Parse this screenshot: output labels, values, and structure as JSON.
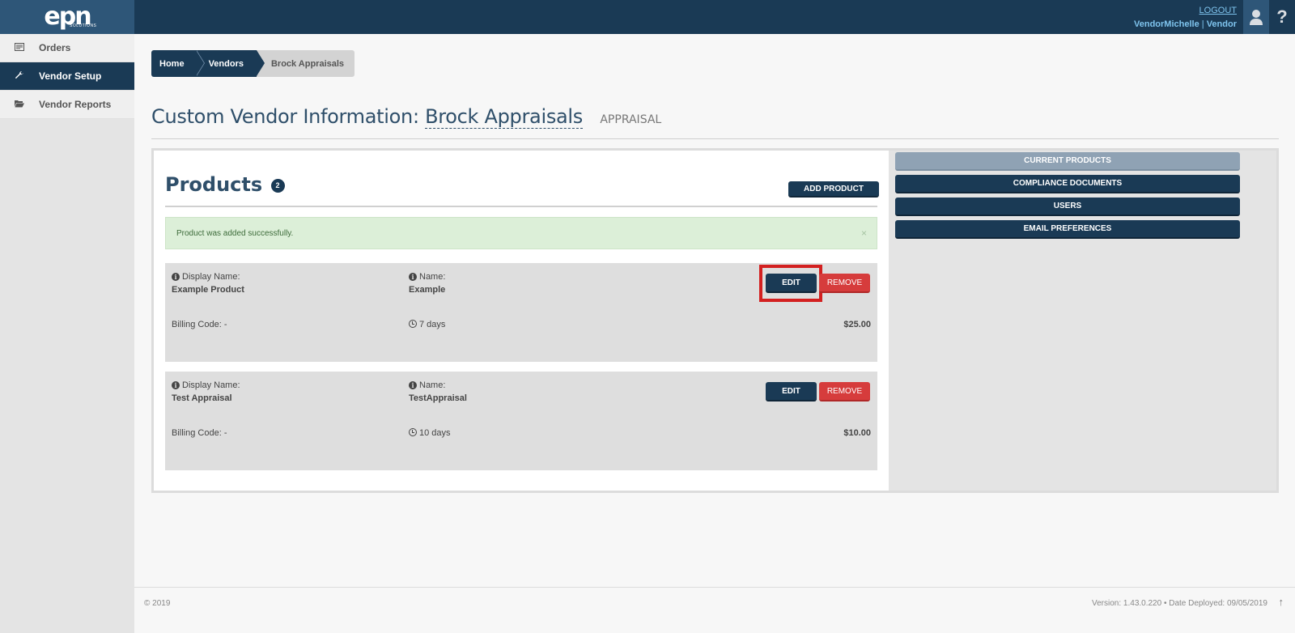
{
  "header": {
    "logo": "epn",
    "logo_sub": "SOLUTIONS",
    "logout": "LOGOUT",
    "username": "VendorMichelle",
    "separator": "|",
    "role": "Vendor",
    "help_glyph": "?"
  },
  "sidebar": {
    "items": [
      {
        "label": "Orders",
        "icon": "orders-icon"
      },
      {
        "label": "Vendor Setup",
        "icon": "wrench-icon",
        "active": true
      },
      {
        "label": "Vendor Reports",
        "icon": "folder-open-icon"
      }
    ]
  },
  "breadcrumb": [
    "Home",
    "Vendors",
    "Brock Appraisals"
  ],
  "page": {
    "title_prefix": "Custom Vendor Information:",
    "vendor_name": "Brock Appraisals",
    "vendor_type": "APPRAISAL"
  },
  "products": {
    "heading": "Products",
    "count": "2",
    "add_button": "ADD PRODUCT",
    "alert": "Product was added successfully.",
    "alert_close": "×",
    "display_name_label": "Display Name:",
    "name_label": "Name:",
    "billing_label_prefix": "Billing Code:",
    "edit_label": "EDIT",
    "remove_label": "REMOVE",
    "items": [
      {
        "display_name": "Example Product",
        "name": "Example",
        "billing": "Billing Code: -",
        "turnaround": "7 days",
        "price": "$25.00"
      },
      {
        "display_name": "Test Appraisal",
        "name": "TestAppraisal",
        "billing": "Billing Code: -",
        "turnaround": "10 days",
        "price": "$10.00"
      }
    ]
  },
  "side_tabs": [
    "CURRENT PRODUCTS",
    "COMPLIANCE DOCUMENTS",
    "USERS",
    "EMAIL PREFERENCES"
  ],
  "footer": {
    "copyright": "© 2019",
    "version": "Version: 1.43.0.220  •  Date Deployed: 09/05/2019"
  },
  "colors": {
    "navy": "#1a3a55",
    "danger": "#d63c3c",
    "success_bg": "#dcefd8",
    "highlight": "#d32020"
  }
}
